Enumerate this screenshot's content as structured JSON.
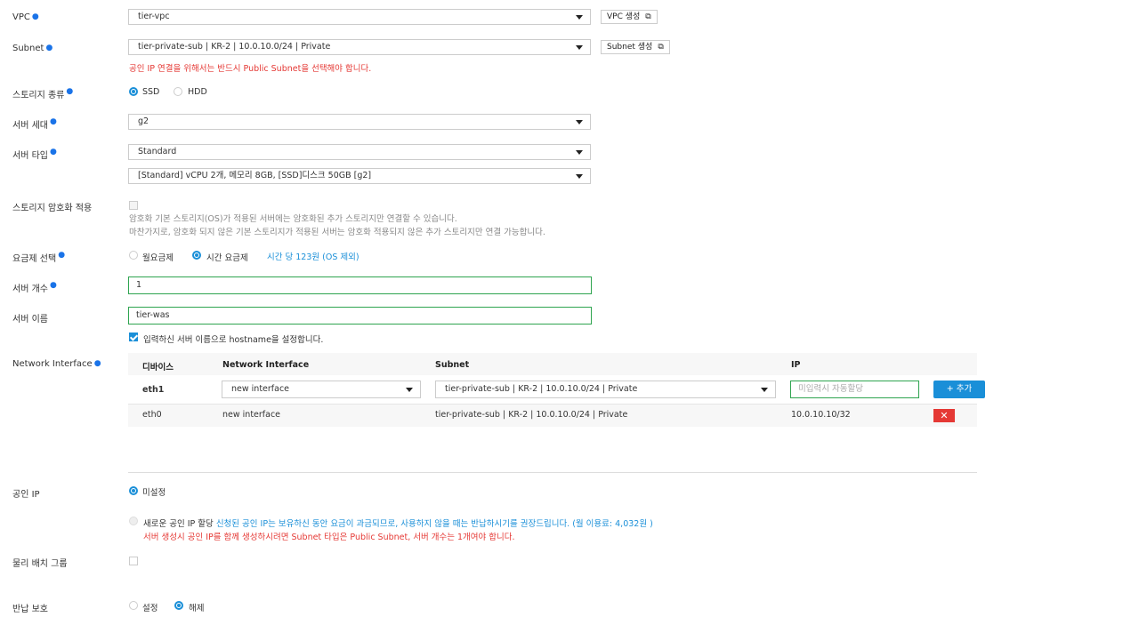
{
  "vpc": {
    "label": "VPC",
    "value": "tier-vpc",
    "create_button": "VPC 생성"
  },
  "subnet": {
    "label": "Subnet",
    "value": "tier-private-sub | KR-2 | 10.0.10.0/24 | Private",
    "create_button": "Subnet 생성",
    "warning": "공인 IP 연결을 위해서는 반드시 Public Subnet을 선택해야 합니다."
  },
  "storage_type": {
    "label": "스토리지 종류",
    "options": [
      "SSD",
      "HDD"
    ],
    "selected": "SSD"
  },
  "server_gen": {
    "label": "서버 세대",
    "value": "g2"
  },
  "server_type": {
    "label": "서버 타입",
    "value": "Standard",
    "spec_value": "[Standard] vCPU 2개, 메모리 8GB, [SSD]디스크 50GB [g2]"
  },
  "storage_encryption": {
    "label": "스토리지 암호화 적용",
    "note1": "암호화 기본 스토리지(OS)가 적용된 서버에는 암호화된 추가 스토리지만 연결할 수 있습니다.",
    "note2": "마찬가지로, 암호화 되지 않은 기본 스토리지가 적용된 서버는 암호화 적용되지 않은 추가 스토리지만 연결 가능합니다."
  },
  "pricing": {
    "label": "요금제 선택",
    "options": [
      "월요금제",
      "시간 요금제"
    ],
    "selected": "시간 요금제",
    "price_note": "시간 당 123원 (OS 제외)"
  },
  "server_count": {
    "label": "서버 개수",
    "value": "1"
  },
  "server_name": {
    "label": "서버 이름",
    "value": "tier-was",
    "hostname_check": "입력하신 서버 이름으로 hostname을 설정합니다."
  },
  "network_interface": {
    "label": "Network Interface",
    "headers": [
      "디바이스",
      "Network Interface",
      "Subnet",
      "IP"
    ],
    "edit_row": {
      "device": "eth1",
      "interface": "new interface",
      "subnet": "tier-private-sub | KR-2 | 10.0.10.0/24 | Private",
      "ip_placeholder": "미입력시 자동할당",
      "add_button": "+ 추가"
    },
    "rows": [
      {
        "device": "eth0",
        "interface": "new interface",
        "subnet": "tier-private-sub | KR-2 | 10.0.10.0/24 | Private",
        "ip": "10.0.10.10/32"
      }
    ],
    "delete_icon": "✕"
  },
  "public_ip": {
    "label": "공인 IP",
    "option_unset": "미설정",
    "option_new": "새로운 공인 IP 할당",
    "option_new_note": "신청된 공인 IP는 보유하신 동안 요금이 과금되므로, 사용하지 않을 때는 반납하시기를 권장드립니다. (월 이용료: 4,032원 )",
    "option_new_warning": "서버 생성시 공인 IP를 함께 생성하시려면 Subnet 타입은 Public Subnet, 서버 개수는 1개여야 합니다."
  },
  "placement_group": {
    "label": "물리 배치 그룹"
  },
  "return_protection": {
    "label": "반납 보호",
    "options": [
      "설정",
      "해제"
    ],
    "selected": "해제"
  },
  "colors": {
    "accent": "#1a8fd8",
    "error": "#e53935",
    "input_border": "#2ea44f"
  }
}
